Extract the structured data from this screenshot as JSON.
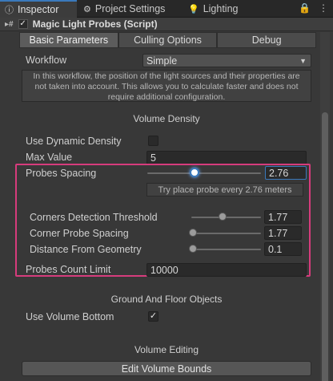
{
  "tabs": [
    {
      "label": "Inspector",
      "icon": "info-icon",
      "active": true
    },
    {
      "label": "Project Settings",
      "icon": "gear-icon",
      "active": false
    },
    {
      "label": "Lighting",
      "icon": "lightbulb-icon",
      "active": false
    }
  ],
  "window_controls": {
    "lock": "🔒",
    "menu": "⋮"
  },
  "component": {
    "title": "Magic Light Probes (Script)",
    "enabled_mark": "✓"
  },
  "toolbar": {
    "items": [
      "Basic Parameters",
      "Culling Options",
      "Debug"
    ],
    "active": 0
  },
  "workflow": {
    "label": "Workflow",
    "value": "Simple"
  },
  "help_text": {
    "line1": "In this workflow, the position of the light sources and their properties are",
    "line2": "not taken into account. This allows you to calculate faster and does not",
    "line3": "require additional configuration."
  },
  "sections": {
    "volume_density": "Volume Density",
    "ground_floor": "Ground And Floor Objects",
    "volume_editing": "Volume Editing"
  },
  "use_dynamic_density": {
    "label": "Use Dynamic Density",
    "checked": false
  },
  "max_value": {
    "label": "Max Value",
    "value": "5"
  },
  "probes_spacing": {
    "label": "Probes Spacing",
    "value": "2.76",
    "fraction": 0.43,
    "hint": "Try place probe every 2.76 meters"
  },
  "corners_detection": {
    "label": "Corners Detection Threshold",
    "value": "1.77",
    "fraction": 0.45
  },
  "corner_probe_spacing": {
    "label": "Corner Probe Spacing",
    "value": "1.77",
    "fraction": 0.02
  },
  "distance_from_geometry": {
    "label": "Distance From Geometry",
    "value": "0.1",
    "fraction": 0.02
  },
  "probes_count_limit": {
    "label": "Probes Count Limit",
    "value": "10000"
  },
  "use_volume_bottom": {
    "label": "Use Volume Bottom",
    "checked": true,
    "mark": "✓"
  },
  "edit_volume_bounds": {
    "label": "Edit Volume Bounds"
  },
  "colors": {
    "accent": "#3a79bb",
    "highlight": "#d63c7c"
  }
}
